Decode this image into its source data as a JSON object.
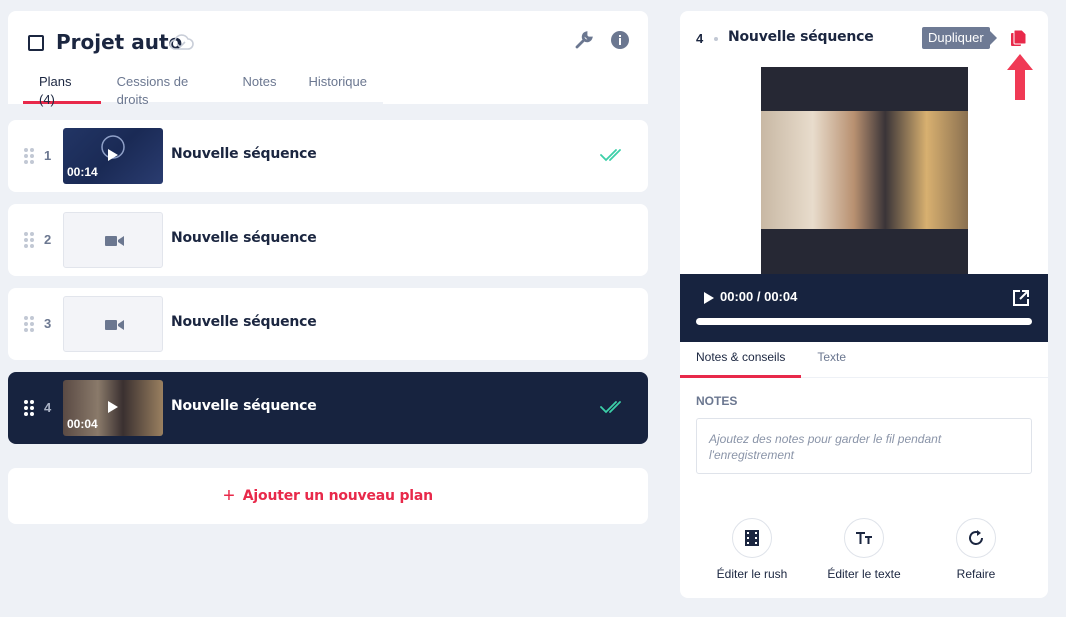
{
  "project": {
    "title": "Projet auto",
    "tabs": [
      "Plans (4)",
      "Cessions de droits",
      "Notes",
      "Historique"
    ]
  },
  "plans": [
    {
      "num": "1",
      "title": "Nouvelle séquence",
      "duration": "00:14"
    },
    {
      "num": "2",
      "title": "Nouvelle séquence"
    },
    {
      "num": "3",
      "title": "Nouvelle séquence"
    },
    {
      "num": "4",
      "title": "Nouvelle séquence",
      "duration": "00:04"
    }
  ],
  "add_plan": {
    "label": "Ajouter un nouveau plan"
  },
  "detail": {
    "num": "4",
    "title": "Nouvelle séquence",
    "tooltip": "Dupliquer",
    "player": {
      "time": "00:00 / 00:04",
      "progress": 0
    },
    "tabs": [
      "Notes & conseils",
      "Texte"
    ],
    "notes_label": "NOTES",
    "notes_placeholder": "Ajoutez des notes pour garder le fil pendant l'enregistrement",
    "actions": [
      "Éditer le rush",
      "Éditer le texte",
      "Refaire"
    ]
  },
  "colors": {
    "accent": "#e8294a",
    "navy": "#17233f",
    "check": "#3ccfa8"
  }
}
